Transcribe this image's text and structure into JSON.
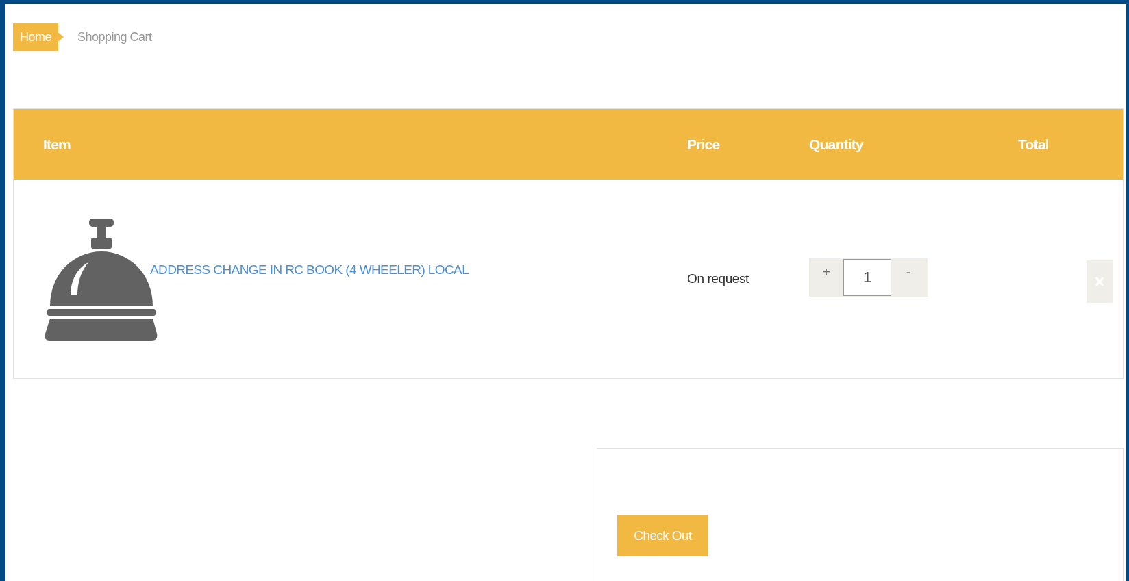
{
  "breadcrumb": [
    {
      "label": "Home",
      "kind": "link"
    },
    {
      "label": "Shopping Cart",
      "kind": "current"
    }
  ],
  "cart": {
    "columns": [
      "Item",
      "Price",
      "Quantity",
      "Total"
    ],
    "rows": [
      {
        "item": "ADDRESS CHANGE IN RC BOOK (4 WHEELER) LOCAL",
        "price": "On request",
        "increment": "+",
        "quantity": "1",
        "decrement": "-"
      }
    ]
  },
  "summary": {
    "button": "Check Out"
  }
}
